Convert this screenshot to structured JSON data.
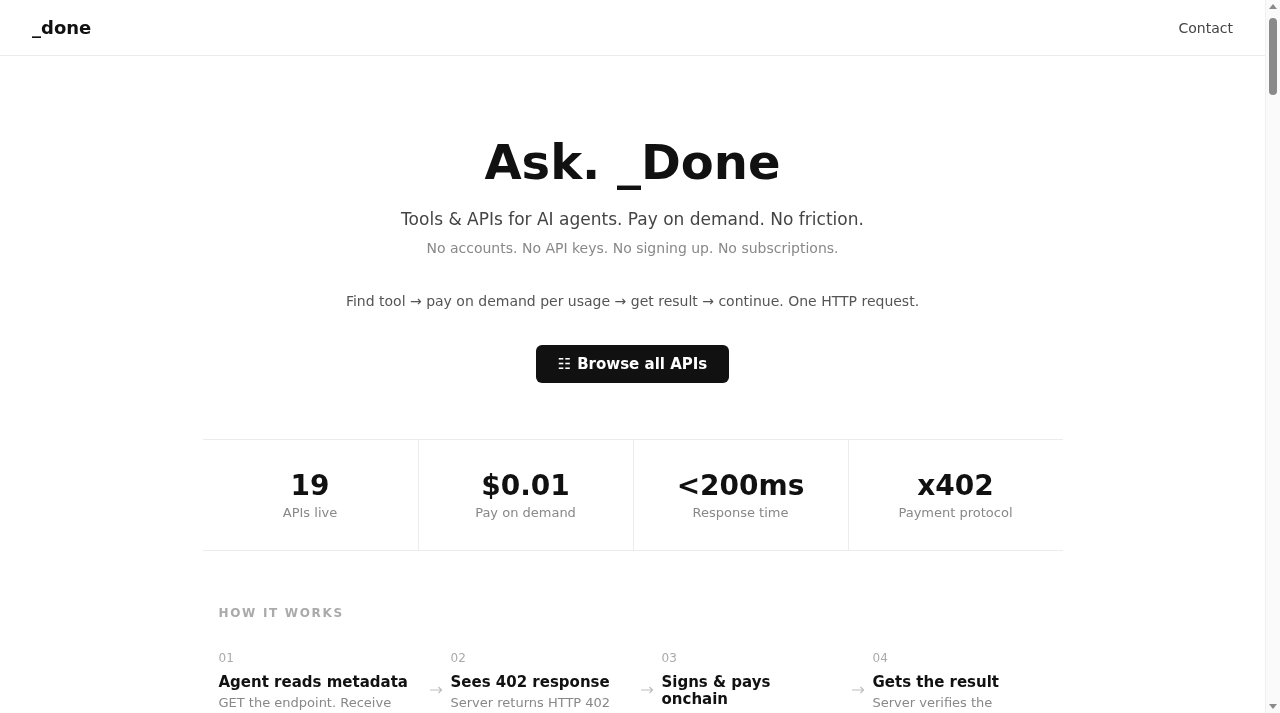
{
  "header": {
    "logo": "_done",
    "nav": [
      "Contact"
    ]
  },
  "hero": {
    "title": "Ask. _Done",
    "subtitle": "Tools & APIs for AI agents. Pay on demand. No friction.",
    "note": "No accounts. No API keys. No signing up. No subscriptions.",
    "flow": "Find tool → pay on demand per usage → get result → continue. One HTTP request.",
    "button": {
      "icon": "☷",
      "label": "Browse all APIs"
    }
  },
  "stats": [
    {
      "value": "19",
      "label": "APIs live"
    },
    {
      "value": "$0.01",
      "label": "Pay on demand"
    },
    {
      "value": "<200ms",
      "label": "Response time"
    },
    {
      "value": "x402",
      "label": "Payment protocol"
    }
  ],
  "how_it_works": {
    "heading": "HOW IT WORKS",
    "steps": [
      {
        "number": "01",
        "title": "Agent reads metadata",
        "description": "GET the endpoint. Receive"
      },
      {
        "number": "02",
        "title": "Sees 402 response",
        "description": "Server returns HTTP 402"
      },
      {
        "number": "03",
        "title": "Signs & pays onchain"
      },
      {
        "number": "04",
        "title": "Gets the result",
        "description": "Server verifies the"
      }
    ]
  }
}
